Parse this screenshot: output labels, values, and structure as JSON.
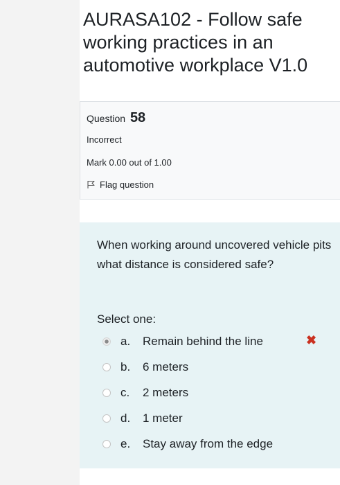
{
  "page": {
    "title": "AURASA102 - Follow safe working practices in an automotive workplace V1.0"
  },
  "info": {
    "question_label": "Question",
    "question_number": "58",
    "state": "Incorrect",
    "grade": "Mark 0.00 out of 1.00",
    "flag_label": "Flag question"
  },
  "question": {
    "text": "When working around uncovered vehicle pits what distance is considered safe?",
    "prompt": "Select one:",
    "answers": [
      {
        "letter": "a.",
        "text": "Remain behind the line",
        "selected": true
      },
      {
        "letter": "b.",
        "text": "6 meters",
        "selected": false
      },
      {
        "letter": "c.",
        "text": "2 meters",
        "selected": false
      },
      {
        "letter": "d.",
        "text": "1 meter",
        "selected": false
      },
      {
        "letter": "e.",
        "text": "Stay away from the edge",
        "selected": false
      }
    ]
  },
  "feedback": {
    "incorrect_symbol": "✖",
    "incorrect_color": "#ca3120"
  },
  "colors": {
    "content_background": "#e7f3f5",
    "info_background": "#f8f9fa",
    "left_strip": "#f3f3f3"
  }
}
